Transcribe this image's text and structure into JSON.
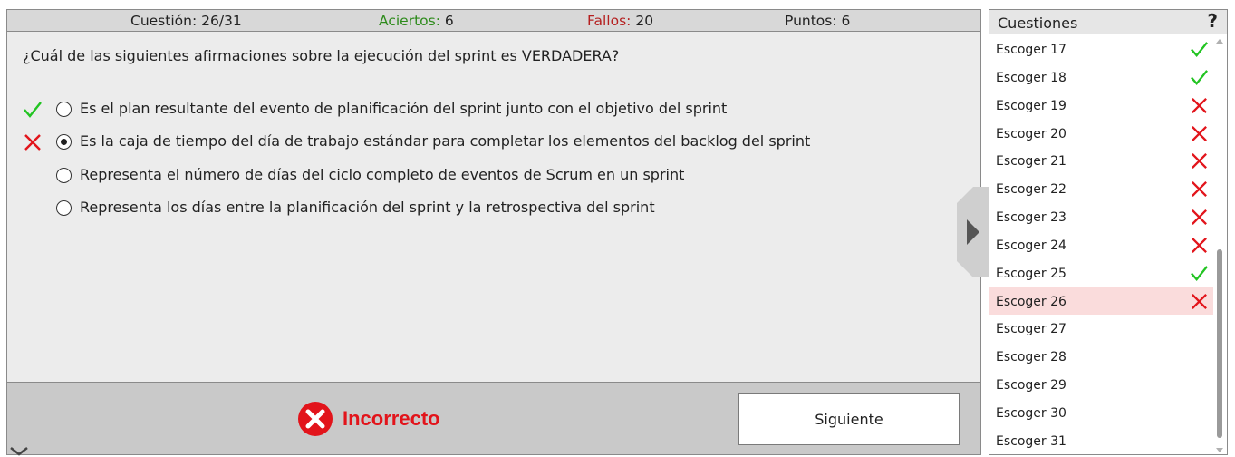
{
  "stats": {
    "question_label": "Cuestión:",
    "question_value": "26/31",
    "correct_label": "Aciertos:",
    "correct_value": "6",
    "wrong_label": "Fallos:",
    "wrong_value": "20",
    "points_label": "Puntos:",
    "points_value": "6"
  },
  "question": "¿Cuál de las siguientes afirmaciones sobre la ejecución del sprint es VERDADERA?",
  "options": [
    {
      "text": "Es el plan resultante del evento de planificación del sprint junto con el objetivo del sprint",
      "mark": "check",
      "selected": false
    },
    {
      "text": "Es la caja de tiempo del día de trabajo estándar para completar los elementos del backlog del sprint",
      "mark": "cross",
      "selected": true
    },
    {
      "text": "Representa el número de días del ciclo completo de eventos de Scrum en un sprint",
      "mark": "none",
      "selected": false
    },
    {
      "text": "Representa los días entre la planificación del sprint y la retrospectiva del sprint",
      "mark": "none",
      "selected": false
    }
  ],
  "result": {
    "text": "Incorrecto",
    "icon": "error-circle-icon"
  },
  "next_button": "Siguiente",
  "sidebar": {
    "title": "Cuestiones",
    "help": "?",
    "items": [
      {
        "label": "Escoger 17",
        "status": "correct"
      },
      {
        "label": "Escoger 18",
        "status": "correct"
      },
      {
        "label": "Escoger 19",
        "status": "wrong"
      },
      {
        "label": "Escoger 20",
        "status": "wrong"
      },
      {
        "label": "Escoger 21",
        "status": "wrong"
      },
      {
        "label": "Escoger 22",
        "status": "wrong"
      },
      {
        "label": "Escoger 23",
        "status": "wrong"
      },
      {
        "label": "Escoger 24",
        "status": "wrong"
      },
      {
        "label": "Escoger 25",
        "status": "correct"
      },
      {
        "label": "Escoger 26",
        "status": "wrong",
        "current": true
      },
      {
        "label": "Escoger 27",
        "status": "none"
      },
      {
        "label": "Escoger 28",
        "status": "none"
      },
      {
        "label": "Escoger 29",
        "status": "none"
      },
      {
        "label": "Escoger 30",
        "status": "none"
      },
      {
        "label": "Escoger 31",
        "status": "none"
      }
    ]
  },
  "colors": {
    "check": "#22c422",
    "cross": "#e2141b",
    "current_row": "#fadcdc",
    "correct_text": "#2e8b1c",
    "wrong_text": "#b52020"
  }
}
